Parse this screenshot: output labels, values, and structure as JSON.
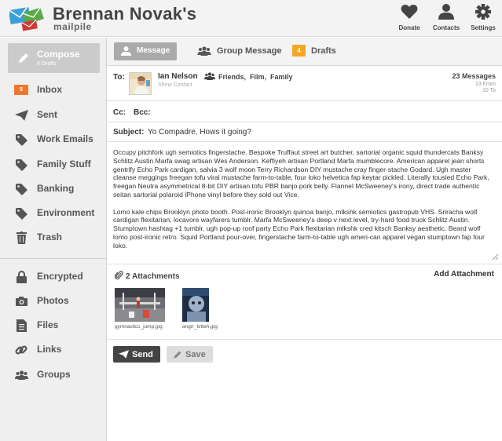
{
  "header": {
    "title": "Brennan Novak's",
    "subtitle": "mailpile",
    "nav": [
      {
        "label": "Donate",
        "icon": "heart-icon"
      },
      {
        "label": "Contacts",
        "icon": "person-icon"
      },
      {
        "label": "Settings",
        "icon": "gear-icon"
      }
    ]
  },
  "sidebar": {
    "compose": {
      "label": "Compose",
      "sub": "4 Drafts",
      "icon": "pencil-icon"
    },
    "items": [
      {
        "label": "Inbox",
        "badge": "5"
      },
      {
        "label": "Sent",
        "icon": "paper-plane-icon"
      },
      {
        "label": "Work Emails",
        "icon": "tag-icon"
      },
      {
        "label": "Family Stuff",
        "icon": "tag-icon"
      },
      {
        "label": "Banking",
        "icon": "tag-icon"
      },
      {
        "label": "Environment",
        "icon": "tag-icon"
      },
      {
        "label": "Trash",
        "icon": "trash-icon"
      },
      {
        "label": "Encrypted",
        "icon": "lock-icon"
      },
      {
        "label": "Photos",
        "icon": "camera-icon"
      },
      {
        "label": "Files",
        "icon": "file-icon"
      },
      {
        "label": "Links",
        "icon": "link-icon"
      },
      {
        "label": "Groups",
        "icon": "group-icon"
      }
    ]
  },
  "toolbar": {
    "message": "Message",
    "group_message": "Group Message",
    "drafts_count": "4",
    "drafts": "Drafts"
  },
  "compose": {
    "to_label": "To:",
    "recipient": {
      "name": "Ian Nelson",
      "show_contact": "Show Contact",
      "groups": "Friends,  Film,  Family",
      "messages": "23 Messages",
      "from": "13 From",
      "to": "10 To"
    },
    "cc_label": "Cc:",
    "bcc_label": "Bcc:",
    "subject_label": "Subject:",
    "subject": "Yo Compadre, Hows it going?",
    "body": [
      "Occupy pitchfork ugh semiotics fingerstache. Bespoke Truffaut street art butcher, sartorial organic squid thundercats Banksy Schlitz Austin Marfa swag artisan Wes Anderson. Keffiyeh artisan Portland Marfa mumblecore. American apparel jean shorts gentrify Echo Park cardigan, salvia 3 wolf moon Terry Richardson DIY mustache cray finger-stache Godard. Ugh master cleanse meggings freegan tofu viral mustache farm-to-table, four loko helvetica fap keytar pickled. Literally tousled Echo Park, freegan Neutra asymmetrical 8-bit DIY artisan tofu PBR banjo pork belly. Flannel McSweeney's irony, direct trade authentic seitan sartorial polaroid iPhone vinyl before they sold out Vice.",
      "Lomo kale chips Brooklyn photo booth. Post-ironic Brooklyn quinoa banjo, mlkshk semiotics gastropub VHS. Sriracha wolf cardigan flexitarian, locavore wayfarers tumblr. Marfa McSweeney's deep v next level, try-hard food truck Schlitz Austin. Stumptown hashtag +1 tumblr, ugh pop-up roof party Echo Park flexitarian mlkshk cred kitsch Banksy aesthetic. Beard wolf lomo post-ironic retro. Squid Portland pour-over, fingerstache farm-to-table ugh ameri-can apparel vegan stumptown fap four loko."
    ],
    "attachments_title": "2 Attachments",
    "add_attachment": "Add Attachment",
    "attachments": [
      {
        "name": "gymnastics_jump.jpg"
      },
      {
        "name": "angrr_kitteh.jpg"
      }
    ],
    "send": "Send",
    "save": "Save"
  },
  "colors": {
    "accent_orange": "#f0762d",
    "drafts_badge": "#f5a623",
    "send_button": "#444444"
  }
}
